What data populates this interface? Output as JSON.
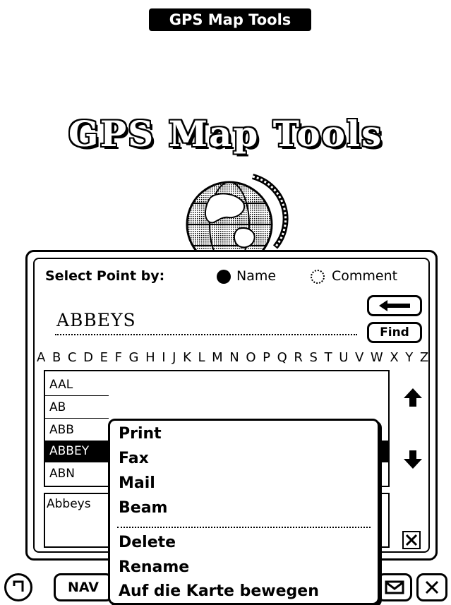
{
  "window": {
    "title": "GPS Map Tools"
  },
  "splash": {
    "title": "GPS Map Tools"
  },
  "dialog": {
    "select_label": "Select Point by:",
    "radio_name": "Name",
    "radio_comment": "Comment",
    "name_value": "ABBEYS",
    "find_label": "Find",
    "alphabet": "ABCDEFGHIJKLMNOPQRSTUVWXYZ",
    "list": [
      "AAL",
      "AB",
      "ABB",
      "ABBEY",
      "ABN"
    ],
    "selected_index": 3,
    "comment_value": "Abbeys"
  },
  "menu": {
    "items_top": [
      "Print",
      "Fax",
      "Mail",
      "Beam"
    ],
    "items_bottom": [
      "Delete",
      "Rename",
      "Auf die Karte bewegen"
    ]
  },
  "bottom_bar": {
    "nav_label": "NAV"
  }
}
